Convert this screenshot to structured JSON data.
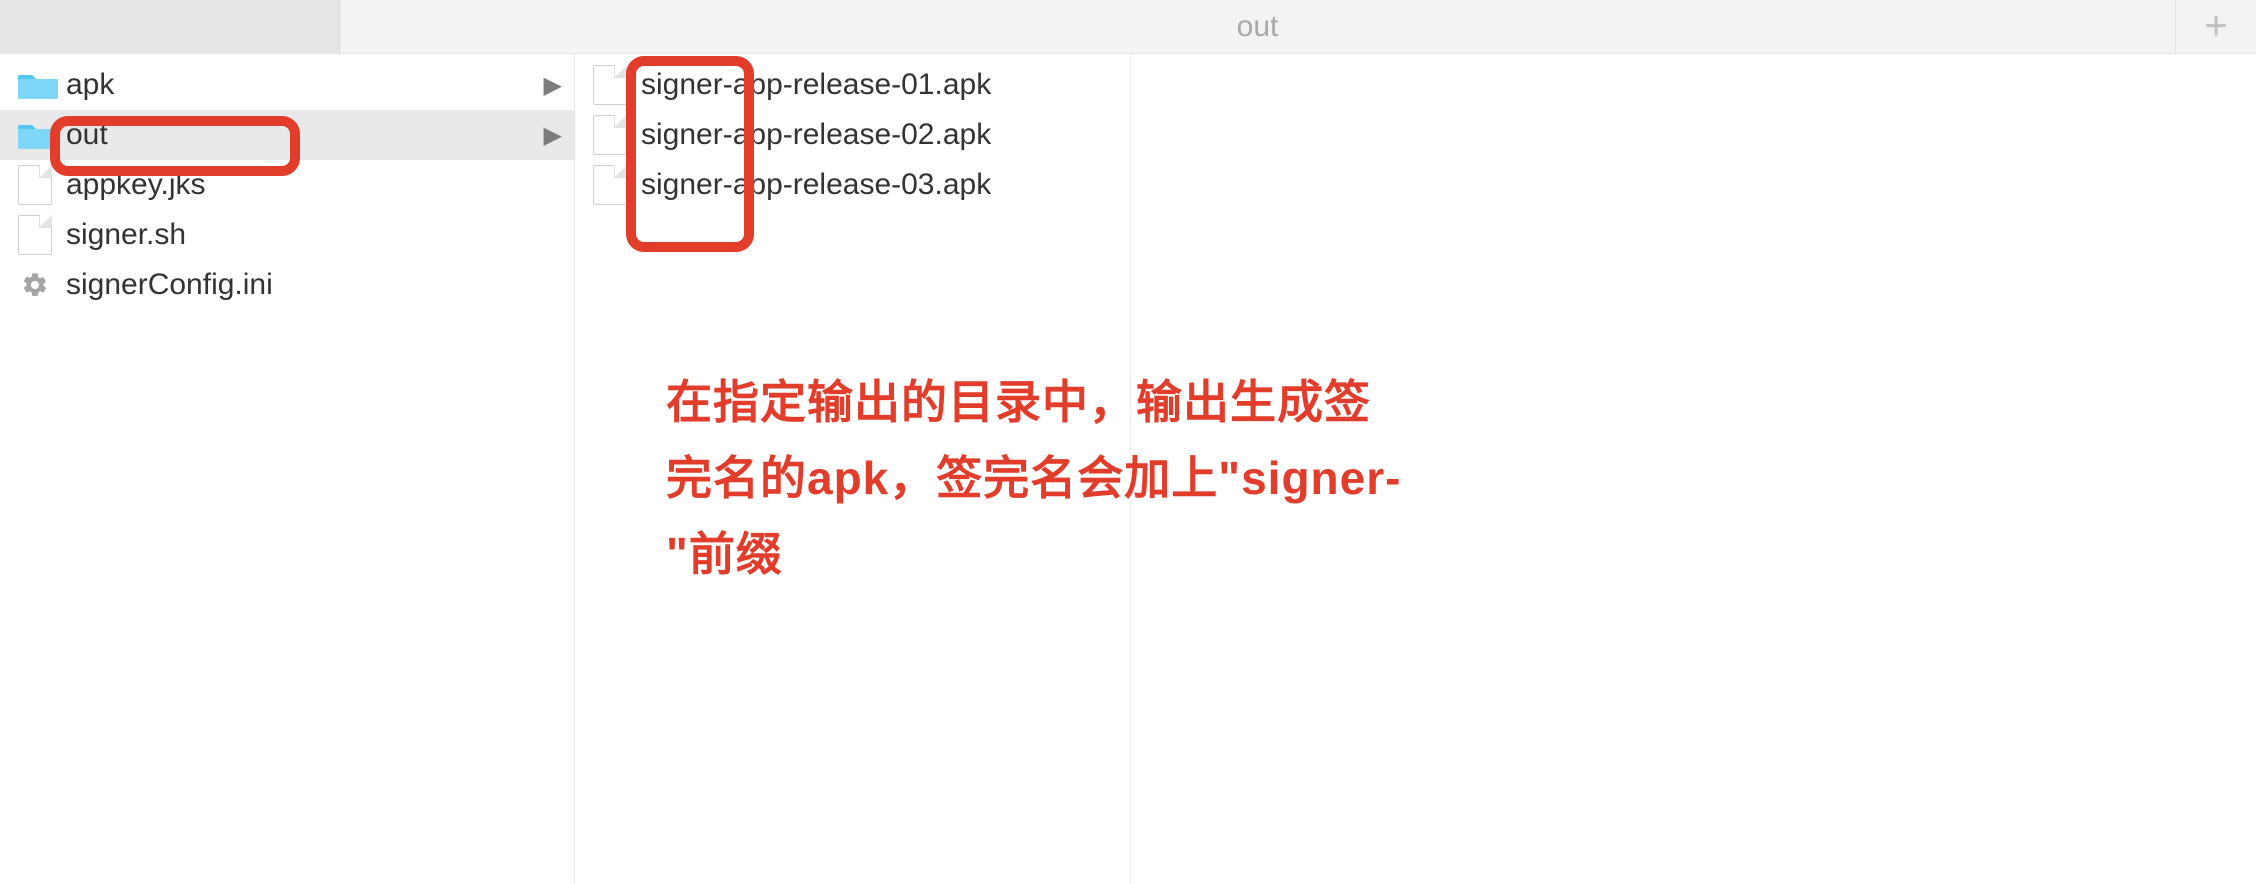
{
  "topbar": {
    "title": "out",
    "plus_label": "+"
  },
  "left_pane": {
    "items": [
      {
        "name": "apk",
        "type": "folder",
        "selected": false,
        "has_children": true
      },
      {
        "name": "out",
        "type": "folder",
        "selected": true,
        "has_children": true
      },
      {
        "name": "appkey.jks",
        "type": "file",
        "selected": false,
        "has_children": false
      },
      {
        "name": "signer.sh",
        "type": "file",
        "selected": false,
        "has_children": false
      },
      {
        "name": "signerConfig.ini",
        "type": "config",
        "selected": false,
        "has_children": false
      }
    ]
  },
  "right_pane": {
    "items": [
      {
        "name": "signer-app-release-01.apk",
        "type": "file"
      },
      {
        "name": "signer-app-release-02.apk",
        "type": "file"
      },
      {
        "name": "signer-app-release-03.apk",
        "type": "file"
      }
    ]
  },
  "annotation": {
    "text": "在指定输出的目录中，输出生成签完名的apk，签完名会加上\"signer-\"前缀"
  },
  "colors": {
    "annotation_red": "#e23c2b",
    "folder_blue": "#56c6f3"
  }
}
